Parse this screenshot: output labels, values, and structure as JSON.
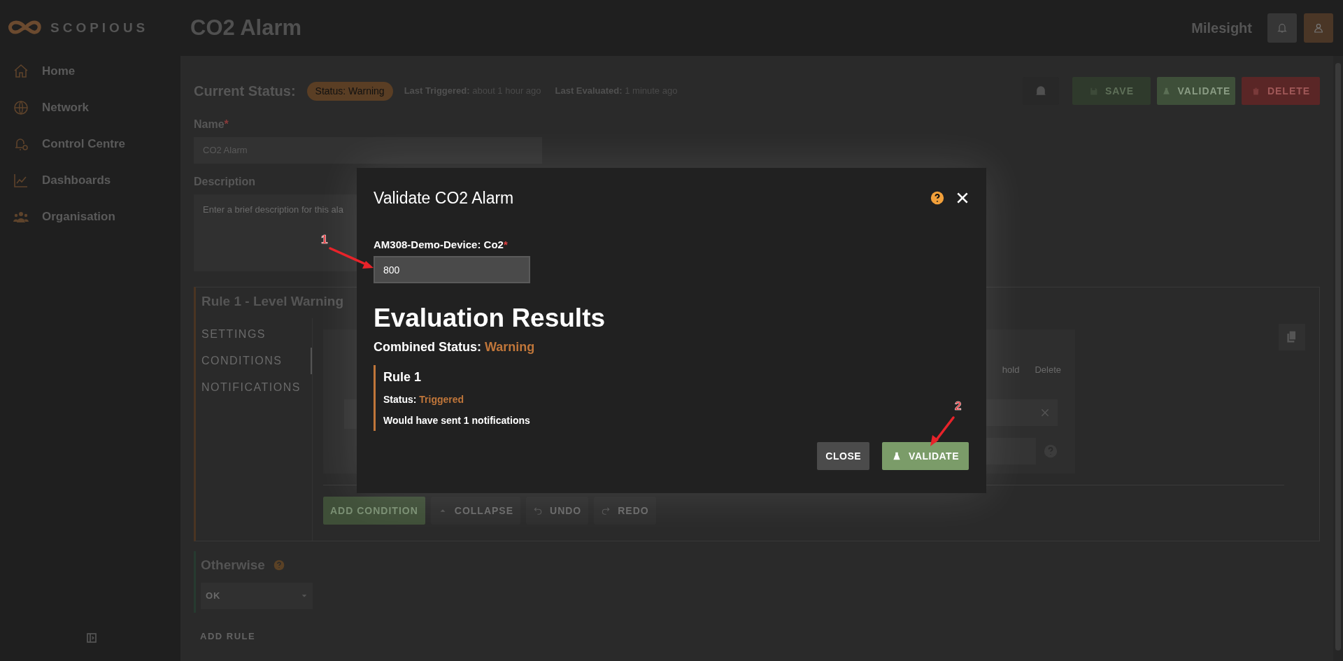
{
  "sidebar": {
    "logo_text": "SCOPIOUS",
    "items": [
      {
        "label": "Home",
        "kind": "home"
      },
      {
        "label": "Network",
        "kind": "globe"
      },
      {
        "label": "Control Centre",
        "kind": "bell"
      },
      {
        "label": "Dashboards",
        "kind": "chart"
      },
      {
        "label": "Organisation",
        "kind": "people"
      }
    ]
  },
  "header": {
    "title": "CO2 Alarm",
    "org": "Milesight"
  },
  "status_bar": {
    "label": "Current Status:",
    "badge": "Status: Warning",
    "last_triggered_label": "Last Triggered:",
    "last_triggered": "about 1 hour ago",
    "last_evaluated_label": "Last Evaluated:",
    "last_evaluated": "1 minute ago"
  },
  "actions": [
    {
      "label": "SAVE",
      "kind": "save"
    },
    {
      "label": "VALIDATE",
      "kind": "validate"
    },
    {
      "label": "DELETE",
      "kind": "delete"
    }
  ],
  "form": {
    "name_label": "Name",
    "name_required_mark": "*",
    "name_value": "CO2 Alarm",
    "description_label": "Description",
    "description_placeholder": "Enter a brief description for this ala"
  },
  "rule": {
    "title": "Rule 1 - Level Warning",
    "tabs": [
      {
        "label": "SETTINGS",
        "selected": false
      },
      {
        "label": "CONDITIONS",
        "selected": true
      },
      {
        "label": "NOTIFICATIONS",
        "selected": false
      }
    ],
    "columns": [
      "hold",
      "Delete"
    ],
    "buttons": [
      {
        "label": "ADD CONDITION",
        "kind": "primary"
      },
      {
        "label": "COLLAPSE",
        "kind": "collapse"
      },
      {
        "label": "UNDO",
        "kind": "undo"
      },
      {
        "label": "REDO",
        "kind": "redo"
      }
    ]
  },
  "otherwise": {
    "title": "Otherwise",
    "select": "OK"
  },
  "add_rule": "ADD RULE",
  "modal": {
    "title": "Validate CO2 Alarm",
    "field_label": "AM308-Demo-Device: Co2",
    "field_required_mark": "*",
    "field_value": "800",
    "heading": "Evaluation Results",
    "combined_label": "Combined Status:",
    "combined_value": "Warning",
    "rules": [
      {
        "title": "Rule 1",
        "status_label": "Status:",
        "status": "Triggered",
        "note": "Would have sent 1 notifications"
      }
    ],
    "buttons": [
      {
        "label": "CLOSE",
        "kind": "close"
      },
      {
        "label": "VALIDATE",
        "kind": "validate"
      }
    ]
  },
  "annotations": [
    {
      "label": "1"
    },
    {
      "label": "2"
    }
  ]
}
